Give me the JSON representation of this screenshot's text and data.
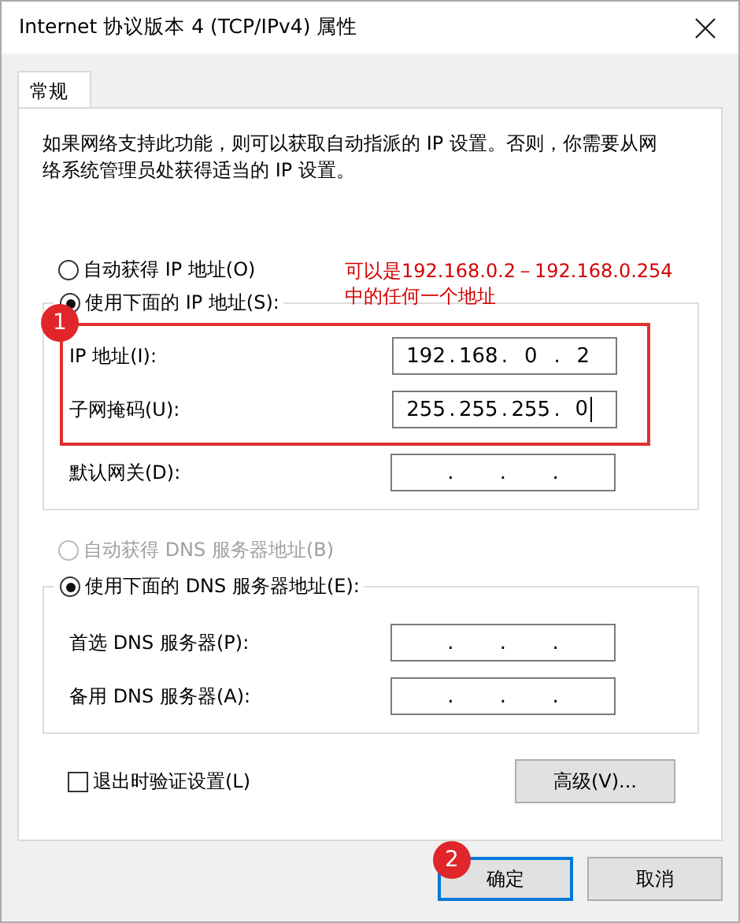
{
  "window": {
    "title": "Internet 协议版本 4 (TCP/IPv4) 属性"
  },
  "tabs": [
    {
      "label": "常规",
      "selected": true
    }
  ],
  "description": "如果网络支持此功能，则可以获取自动指派的 IP 设置。否则，你需要从网络系统管理员处获得适当的 IP 设置。",
  "ip_options": [
    {
      "label": "自动获得 IP 地址(O)",
      "selected": false,
      "disabled": false
    },
    {
      "label": "使用下面的 IP 地址(S):",
      "selected": true,
      "disabled": false
    }
  ],
  "ip_highlight": {
    "marker": "1",
    "fields": [
      {
        "label": "IP 地址(I):",
        "octets": [
          "192",
          "168",
          "0",
          "2"
        ],
        "dots": [
          ".",
          ".",
          "."
        ]
      },
      {
        "label": "子网掩码(U):",
        "octets": [
          "255",
          "255",
          "255",
          "0"
        ],
        "dots": [
          ".",
          ".",
          "."
        ],
        "caret": true
      }
    ]
  },
  "ip_fields": [
    {
      "label": "默认网关(D):",
      "dots": [
        ".",
        ".",
        "."
      ]
    }
  ],
  "note": [
    "可以是192.168.0.2－192.168.0.254",
    "中的任何一个地址"
  ],
  "dns_options": [
    {
      "label": "自动获得 DNS 服务器地址(B)",
      "selected": false,
      "disabled": true
    },
    {
      "label": "使用下面的 DNS 服务器地址(E):",
      "selected": true,
      "disabled": false
    }
  ],
  "dns_fields": [
    {
      "label": "首选 DNS 服务器(P):",
      "dots": [
        ".",
        ".",
        "."
      ]
    },
    {
      "label": "备用 DNS 服务器(A):",
      "dots": [
        ".",
        ".",
        "."
      ]
    }
  ],
  "validate_on_exit": {
    "label": "退出时验证设置(L)",
    "checked": false
  },
  "advanced_button": "高级(V)...",
  "buttons": [
    {
      "label": "确定",
      "focused": true,
      "marker": "2"
    },
    {
      "label": "取消",
      "focused": false
    }
  ]
}
